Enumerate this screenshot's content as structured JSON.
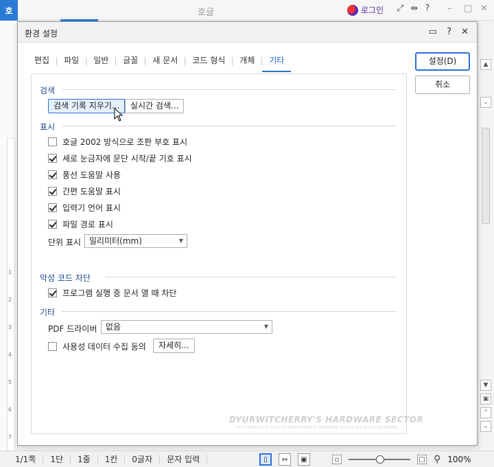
{
  "app": {
    "logo": "호",
    "title": "호글",
    "login_label": "로그인",
    "title_icons": [
      "⤢",
      "⇹",
      "?"
    ],
    "window_controls": [
      "–",
      "□",
      "✕"
    ]
  },
  "dialog": {
    "title": "환경 설정",
    "header_icons": [
      "▭",
      "?",
      "✕"
    ],
    "tabs": [
      "편집",
      "파일",
      "일반",
      "글꼴",
      "새 문서",
      "코드 형식",
      "개체",
      "기타"
    ],
    "active_tab": "기타",
    "buttons": {
      "ok": "설정(D)",
      "cancel": "취소"
    },
    "sections": {
      "search": {
        "title": "검색",
        "clear_history_button": "검색 기록 지우기...",
        "realtime_search_button": "실시간 검색..."
      },
      "display": {
        "title": "표시",
        "options": [
          {
            "label": "호글 2002 방식으로 조판 부호 표시",
            "checked": false
          },
          {
            "label": "세로 눈금자에 문단 시작/끝 기호 표시",
            "checked": true
          },
          {
            "label": "풍선 도움말 사용",
            "checked": true
          },
          {
            "label": "간편 도움말 표시",
            "checked": true
          },
          {
            "label": "입력기 언어 표시",
            "checked": true
          },
          {
            "label": "파일 경로 표시",
            "checked": true
          }
        ],
        "unit_label": "단위 표시",
        "unit_value": "밀리미터(mm)"
      },
      "malicious_code": {
        "title": "악성 코드 차단",
        "option": {
          "label": "프로그램 실행 중 문서 열 때 차단",
          "checked": true
        }
      },
      "other": {
        "title": "기타",
        "pdf_driver_label": "PDF 드라이버",
        "pdf_driver_value": "없음",
        "usage_data": {
          "label": "사용성 데이터 수집 동의",
          "checked": false
        },
        "details_button": "자세히..."
      }
    }
  },
  "statusbar": {
    "page": "1/1쪽",
    "section": "1단",
    "line": "1줄",
    "column": "1칸",
    "chars": "0글자",
    "mode": "문자 입력",
    "zoom": "100%"
  },
  "ruler_numbers": [
    "1",
    "2",
    "3",
    "4",
    "5",
    "6",
    "7"
  ],
  "watermark": {
    "title": "DYURWITCHERRY'S HARDWARE SECTOR",
    "subtitle": "ALL COPYRIGHT© 2015, DYURWITCHERRY'S HARDWARE SECTOR ALL RIGHTS RESERVED."
  },
  "colors": {
    "accent": "#2b6fd6",
    "logo": "#2b7bd6"
  }
}
